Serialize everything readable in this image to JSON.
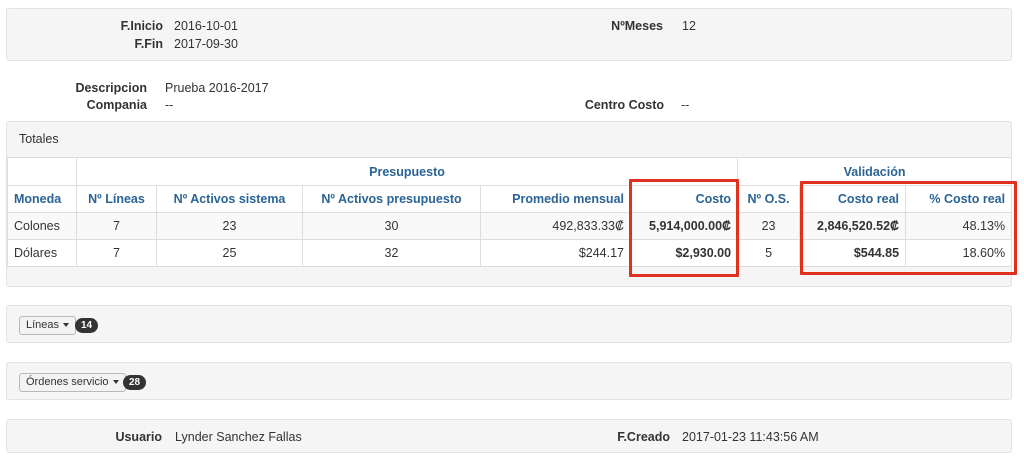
{
  "period": {
    "f_inicio_label": "F.Inicio",
    "f_inicio_value": "2016-10-01",
    "f_fin_label": "F.Fin",
    "f_fin_value": "2017-09-30",
    "meses_label": "NºMeses",
    "meses_value": "12"
  },
  "info": {
    "descripcion_label": "Descripcion",
    "descripcion_value": "Prueba 2016-2017",
    "compania_label": "Compania",
    "compania_value": "--",
    "centro_label": "Centro Costo",
    "centro_value": "--"
  },
  "totales": {
    "title": "Totales",
    "group_presupuesto": "Presupuesto",
    "group_validacion": "Validación",
    "columns": [
      "Moneda",
      "Nº Líneas",
      "Nº Activos sistema",
      "Nº Activos presupuesto",
      "Promedio mensual",
      "Costo",
      "Nº O.S.",
      "Costo real",
      "% Costo real"
    ],
    "rows": [
      [
        "Colones",
        "7",
        "23",
        "30",
        "492,833.33₡",
        "5,914,000.00₡",
        "23",
        "2,846,520.52₡",
        "48.13%"
      ],
      [
        "Dólares",
        "7",
        "25",
        "32",
        "$244.17",
        "$2,930.00",
        "5",
        "$544.85",
        "18.60%"
      ]
    ]
  },
  "lineas": {
    "label": "Líneas",
    "count": "14"
  },
  "ordenes": {
    "label": "Órdenes servicio",
    "count": "28"
  },
  "footer": {
    "usuario_label": "Usuario",
    "usuario_value": "Lynder Sanchez Fallas",
    "fcreado_label": "F.Creado",
    "fcreado_value": "2017-01-23 11:43:56 AM"
  },
  "colors": {
    "header_blue": "#2a6496",
    "highlight_red": "#e0301e",
    "badge": "#333333"
  }
}
